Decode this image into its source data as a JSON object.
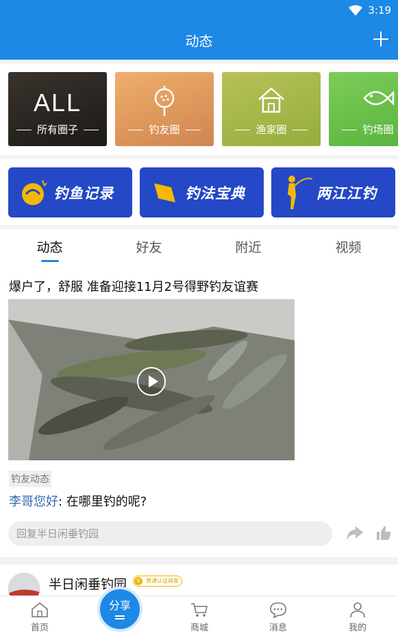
{
  "status_bar": {
    "time": "3:19"
  },
  "header": {
    "title": "动态"
  },
  "circles": [
    {
      "big": "ALL",
      "label": "所有圈子",
      "color": "#2b2622"
    },
    {
      "big": "",
      "label": "钓友圈",
      "color": "#e8a160"
    },
    {
      "big": "",
      "label": "渔家圈",
      "color": "#a6b84a"
    },
    {
      "big": "",
      "label": "钓场圈",
      "color": "#6fc14e"
    }
  ],
  "features": [
    {
      "label": "钓鱼记录"
    },
    {
      "label": "钓法宝典"
    },
    {
      "label": "两江江钓"
    }
  ],
  "tabs": [
    "动态",
    "好友",
    "附近",
    "视频"
  ],
  "post": {
    "text": "爆户了，舒服 准备迎接11月2号得野钓友谊赛",
    "tag": "钓友动态",
    "comment_author": "李哥您好",
    "comment_text": ": 在哪里钓的呢?",
    "reply_placeholder": "回复半日闲垂钓园"
  },
  "post2": {
    "name": "半日闲垂钓园",
    "badge": "普通认证商家"
  },
  "bottom_nav": {
    "home": "首页",
    "share": "分享",
    "mall": "商城",
    "messages": "消息",
    "me": "我的"
  },
  "colors": {
    "primary": "#1e88e5",
    "feature_blue": "#2448c6",
    "link": "#3567b0"
  }
}
